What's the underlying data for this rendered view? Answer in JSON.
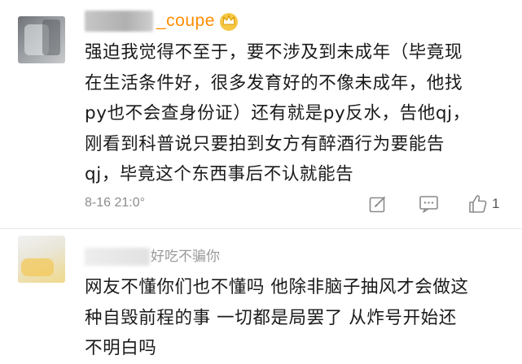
{
  "comments": [
    {
      "username_suffix": "_coupe",
      "badge_icon": "crown-icon",
      "lines": [
        "强迫我觉得不至于，要不涉及到未成年（毕竟现",
        "在生活条件好，很多发育好的不像未成年，他找",
        "py也不会查身份证）还有就是py反水，告他qj，",
        "刚看到科普说只要拍到女方有醉酒行为要能告",
        "qj，毕竟这个东西事后不认就能告"
      ],
      "timestamp": "8-16 21:0°",
      "actions": {
        "edit_icon": "edit-icon",
        "comment_icon": "comment-icon",
        "like_icon": "thumbs-up-icon",
        "like_count": "1"
      }
    },
    {
      "username": "好吃不骗你",
      "lines": [
        "网友不懂你们也不懂吗 他除非脑子抽风才会做这",
        "种自毁前程的事 一切都是局罢了 从炸号开始还",
        "不明白吗"
      ]
    }
  ],
  "colors": {
    "accent_username": "#ff8c00",
    "text": "#1a1a1a",
    "meta": "#8c8c8c"
  }
}
